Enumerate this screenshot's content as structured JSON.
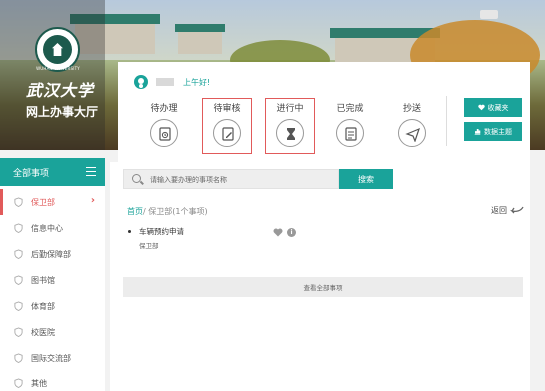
{
  "brand": {
    "calligraphy": "武汉大学",
    "university_en": "WUHAN UNIVERSITY",
    "hall_title": "网上办事大厅"
  },
  "user": {
    "greeting": "上午好!"
  },
  "stats": [
    {
      "label": "待办理",
      "icon": "clipboard-clock-icon"
    },
    {
      "label": "待审核",
      "icon": "edit-document-icon"
    },
    {
      "label": "进行中",
      "icon": "hourglass-icon"
    },
    {
      "label": "已完成",
      "icon": "checklist-icon"
    },
    {
      "label": "抄送",
      "icon": "paper-plane-icon"
    }
  ],
  "actions": {
    "favorites_label": "收藏夹",
    "data_topic_label": "数据主题"
  },
  "sidebar": {
    "header_label": "全部事项",
    "items": [
      {
        "label": "保卫部"
      },
      {
        "label": "信息中心"
      },
      {
        "label": "后勤保障部"
      },
      {
        "label": "图书馆"
      },
      {
        "label": "体育部"
      },
      {
        "label": "校医院"
      },
      {
        "label": "国际交流部"
      },
      {
        "label": "其他"
      }
    ]
  },
  "search": {
    "placeholder": "请输入要办理的事项名称",
    "button_label": "搜索"
  },
  "breadcrumb": {
    "home": "首页",
    "current": "/ 保卫部(1个事项)",
    "back_label": "返回"
  },
  "tasks": [
    {
      "name": "车辆预约申请",
      "dept": "保卫部"
    }
  ],
  "view_all_label": "查看全部事项",
  "colors": {
    "accent": "#1aa39a",
    "highlight": "#e15a5a"
  }
}
